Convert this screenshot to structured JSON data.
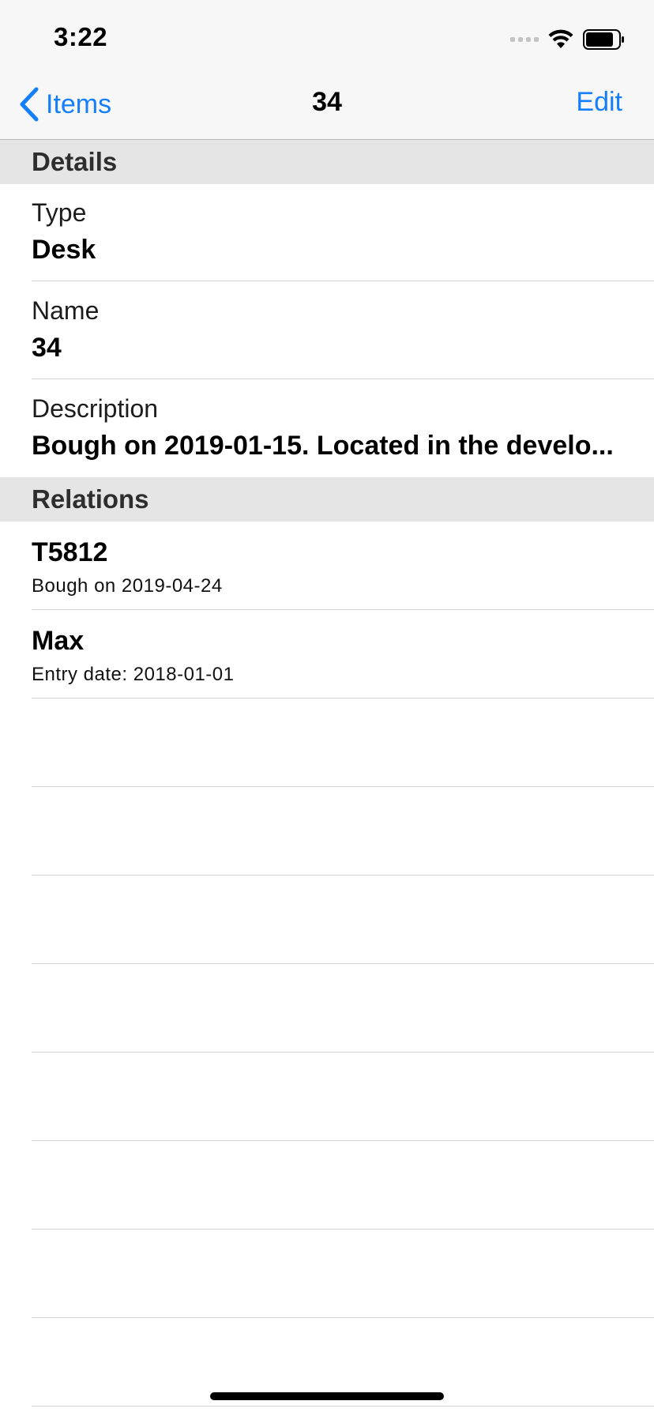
{
  "status_bar": {
    "time": "3:22"
  },
  "nav": {
    "back_label": "Items",
    "title": "34",
    "edit_label": "Edit"
  },
  "sections": {
    "details_header": "Details",
    "relations_header": "Relations"
  },
  "details": [
    {
      "label": "Type",
      "value": "Desk"
    },
    {
      "label": "Name",
      "value": "34"
    },
    {
      "label": "Description",
      "value": "Bough on 2019-01-15. Located in the develo..."
    }
  ],
  "relations": [
    {
      "title": "T5812",
      "subtitle": "Bough on 2019-04-24"
    },
    {
      "title": "Max",
      "subtitle": "Entry date: 2018-01-01"
    }
  ],
  "colors": {
    "accent": "#147efb",
    "section_bg": "#e5e5e5",
    "bar_bg": "#f7f7f7"
  }
}
